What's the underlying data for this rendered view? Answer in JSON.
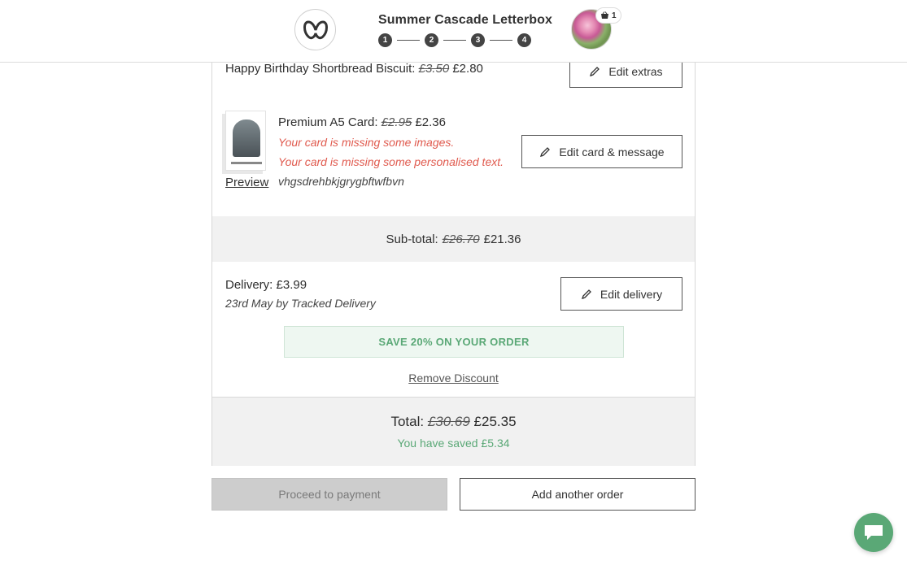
{
  "header": {
    "logo_icon": "brand-loop-icon",
    "title": "Summer Cascade Letterbox",
    "steps": [
      "1",
      "2",
      "3",
      "4"
    ],
    "basket_count": "1"
  },
  "order": {
    "extras_item": {
      "name": "Happy Birthday Shortbread Biscuit:",
      "old_price": "£3.50",
      "price": "£2.80",
      "edit_label": "Edit extras"
    },
    "card_item": {
      "name": "Premium A5 Card:",
      "old_price": "£2.95",
      "price": "£2.36",
      "warning_images": "Your card is missing some images.",
      "warning_text": "Your card is missing some personalised text.",
      "message": "vhgsdrehbkjgrygbftwfbvn",
      "preview_label": "Preview",
      "edit_label": "Edit card & message"
    },
    "subtotal": {
      "label": "Sub-total:",
      "old_price": "£26.70",
      "price": "£21.36"
    },
    "delivery": {
      "label": "Delivery: £3.99",
      "detail": "23rd May by Tracked Delivery",
      "edit_label": "Edit delivery"
    },
    "discount": {
      "promo": "SAVE 20% ON YOUR ORDER",
      "remove_label": "Remove Discount"
    },
    "total": {
      "label": "Total:",
      "old_price": "£30.69",
      "price": "£25.35",
      "saved": "You have saved £5.34"
    }
  },
  "actions": {
    "proceed_label": "Proceed to payment",
    "add_order_label": "Add another order"
  },
  "colors": {
    "accent_green": "#5aa876",
    "warning_red": "#e05a4e",
    "disabled_button": "#cdcdcd"
  },
  "widgets": {
    "chat_icon": "chat-bubble-icon"
  }
}
